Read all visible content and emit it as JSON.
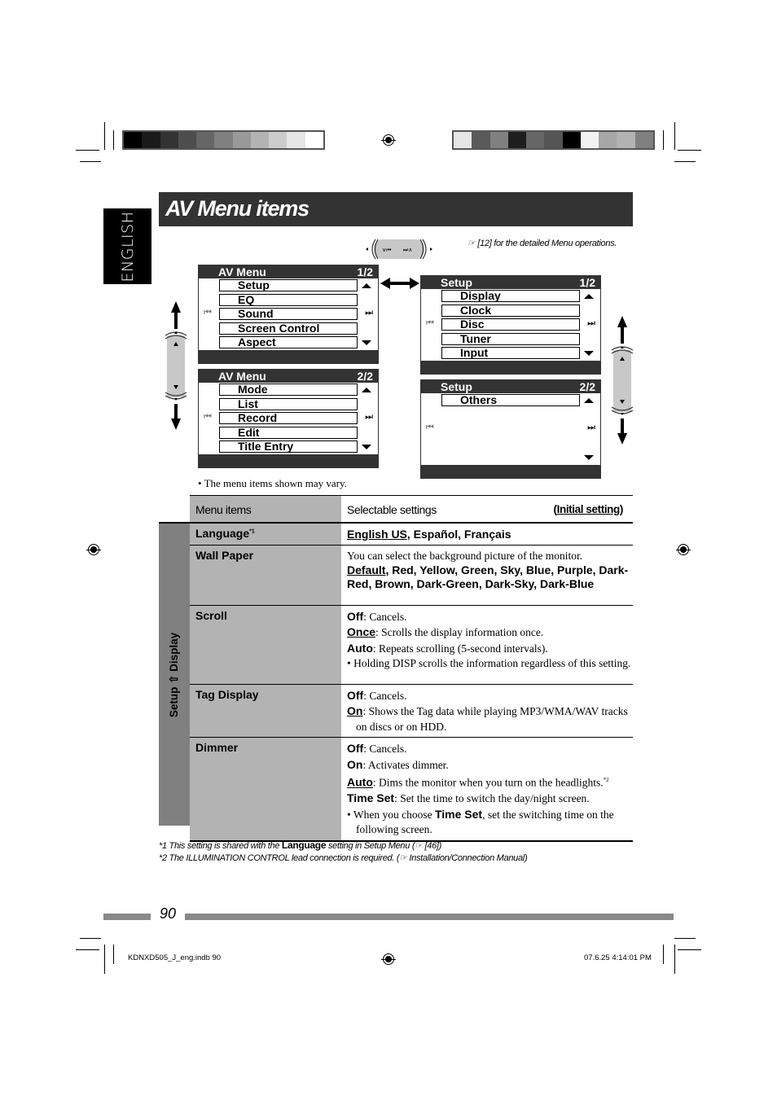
{
  "language_tab": "ENGLISH",
  "title": "AV Menu items",
  "reference_note": "☞ [12] for the detailed Menu operations.",
  "swatches_left": [
    "#000000",
    "#1a1a1a",
    "#333333",
    "#4d4d4d",
    "#666666",
    "#808080",
    "#999999",
    "#b3b3b3",
    "#cccccc",
    "#e6e6e6",
    "#ffffff"
  ],
  "swatches_right": [
    "#e6e6e6",
    "#5a5a5a",
    "#808080",
    "#1e1e1e",
    "#666666",
    "#555555",
    "#000000",
    "#f2f2f2",
    "#a6a6a6",
    "#b3b3b3",
    "#808080"
  ],
  "knob": {
    "left_label": "∨⏮",
    "right_label": "⏭∧"
  },
  "screens": {
    "av_menu_1": {
      "title": "AV Menu",
      "page": "1/2",
      "items": [
        "Setup",
        "EQ",
        "Sound",
        "Screen Control",
        "Aspect"
      ]
    },
    "av_menu_2": {
      "title": "AV Menu",
      "page": "2/2",
      "items": [
        "Mode",
        "List",
        "Record",
        "Edit",
        "Title Entry"
      ]
    },
    "setup_1": {
      "title": "Setup",
      "page": "1/2",
      "items": [
        "Display",
        "Clock",
        "Disc",
        "Tuner",
        "Input"
      ]
    },
    "setup_2": {
      "title": "Setup",
      "page": "2/2",
      "items": [
        "Others"
      ]
    }
  },
  "icons": {
    "prev": "⏮",
    "next": "⏭"
  },
  "note": "The menu items shown may vary.",
  "table": {
    "header": {
      "col1": "Menu items",
      "col2": "Selectable settings",
      "initial": "Initial setting"
    },
    "side_label": "Setup ⇧ Display",
    "rows": [
      {
        "item": "Language",
        "sup": "*1",
        "lines": [
          {
            "opts": [
              {
                "t": "English US",
                "u": true
              },
              {
                "t": ", Español, Français"
              }
            ]
          }
        ]
      },
      {
        "item": "Wall Paper",
        "desc": "You can select the background picture of the monitor.",
        "opts": [
          {
            "t": "Default",
            "u": true
          },
          {
            "t": ", Red, Yellow, Green, Sky, Blue, Purple, Dark-Red, Brown, Dark-Green, Dark-Sky, Dark-Blue"
          }
        ]
      },
      {
        "item": "Scroll",
        "entries": [
          {
            "k": "Off",
            "u": false,
            "v": ": Cancels."
          },
          {
            "k": "Once",
            "u": true,
            "v": ": Scrolls the display information once."
          },
          {
            "k": "Auto",
            "u": false,
            "v": ": Repeats scrolling (5-second intervals)."
          }
        ],
        "bullet": "Holding DISP scrolls the information regardless of this setting."
      },
      {
        "item": "Tag Display",
        "entries": [
          {
            "k": "Off",
            "u": false,
            "v": ": Cancels."
          },
          {
            "k": "On",
            "u": true,
            "v": ": Shows the Tag data while playing MP3/WMA/WAV tracks on discs or on HDD."
          }
        ]
      },
      {
        "item": "Dimmer",
        "entries": [
          {
            "k": "Off",
            "u": false,
            "v": ": Cancels."
          },
          {
            "k": "On",
            "u": false,
            "v": ": Activates dimmer."
          },
          {
            "k": "Auto",
            "u": true,
            "v": ": Dims the monitor when you turn on the headlights.",
            "sup": "*2"
          },
          {
            "k": "Time Set",
            "u": false,
            "v": ": Set the time to switch the day/night screen."
          }
        ],
        "bullet_pre": "When you choose ",
        "bullet_key": "Time Set",
        "bullet_post": ", set the switching time on the following screen."
      }
    ]
  },
  "footnotes": {
    "fn1_pre": "*1 This setting is shared with the ",
    "fn1_key": "Language",
    "fn1_post": " setting in Setup Menu (☞ [46])",
    "fn2": "*2 The ILLUMINATION CONTROL lead connection is required. (☞ Installation/Connection Manual)"
  },
  "page_number": "90",
  "slug_left": "KDNXD505_J_eng.indb   90",
  "slug_right": "07.6.25   4:14:01 PM"
}
